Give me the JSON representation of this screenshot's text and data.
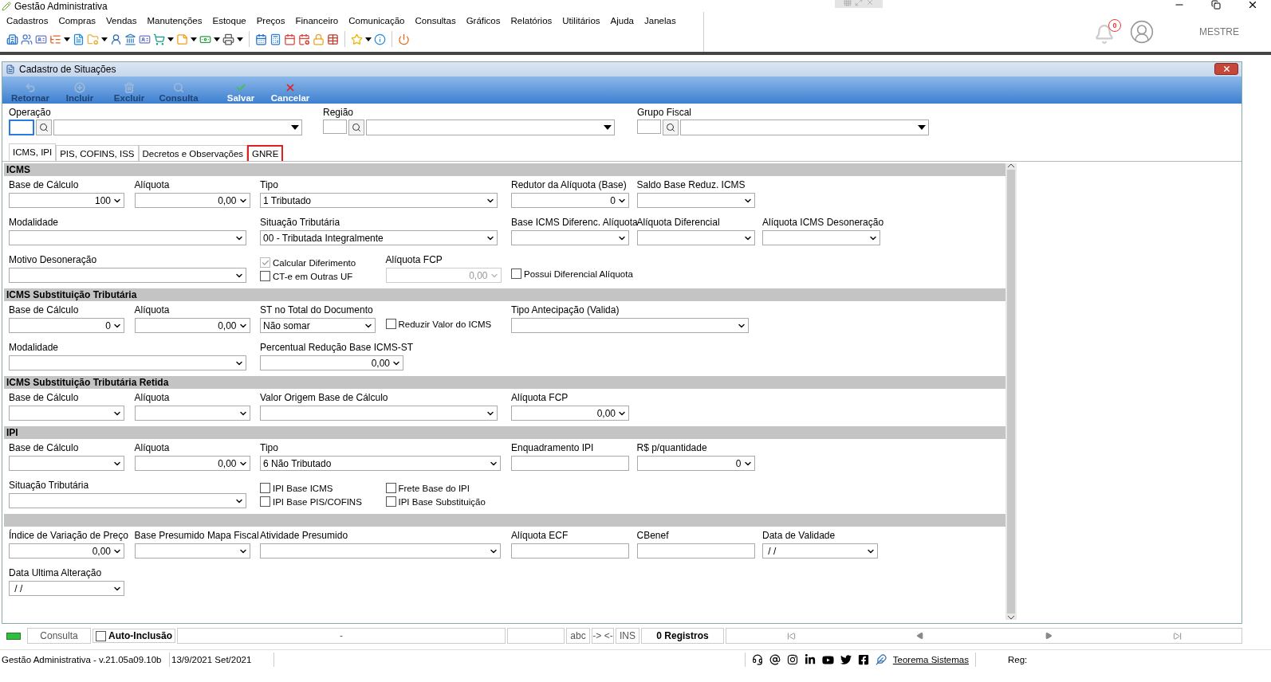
{
  "app": {
    "title": "Gestão Administrativa",
    "menu": [
      "Cadastros",
      "Compras",
      "Vendas",
      "Manutenções",
      "Estoque",
      "Preços",
      "Financeiro",
      "Comunicação",
      "Consultas",
      "Gráficos",
      "Relatórios",
      "Utilitários",
      "Ajuda",
      "Janelas"
    ],
    "notifications": "0",
    "user": "MESTRE"
  },
  "window": {
    "title": "Cadastro de Situações",
    "actions": [
      {
        "label": "Retornar",
        "disabled": true
      },
      {
        "label": "Incluir",
        "disabled": true
      },
      {
        "label": "Excluir",
        "disabled": true
      },
      {
        "label": "Consulta",
        "disabled": true
      },
      {
        "label": "Salvar",
        "disabled": false
      },
      {
        "label": "Cancelar",
        "disabled": false
      }
    ]
  },
  "filters": [
    {
      "label": "Operação",
      "focused": true
    },
    {
      "label": "Região",
      "focused": false
    },
    {
      "label": "Grupo Fiscal",
      "focused": false
    }
  ],
  "tabs": [
    {
      "label": "ICMS, IPI",
      "selected": true,
      "outlined": false
    },
    {
      "label": "PIS, COFINS, ISS",
      "selected": false,
      "outlined": false
    },
    {
      "label": "Decretos e Observações",
      "selected": false,
      "outlined": false
    },
    {
      "label": "GNRE",
      "selected": false,
      "outlined": true
    }
  ],
  "sections": [
    {
      "title": "ICMS",
      "fields": [
        {
          "kind": "number",
          "label": "Base de Cálculo",
          "value": "100",
          "disabled": false
        },
        {
          "kind": "number",
          "label": "Alíquota",
          "value": "0,00",
          "disabled": false
        },
        {
          "kind": "combo",
          "label": "Tipo",
          "value": "1 Tributado",
          "disabled": false
        },
        {
          "kind": "number",
          "label": "Redutor da Alíquota (Base)",
          "value": "0",
          "disabled": false
        },
        {
          "kind": "combo",
          "label": "Saldo Base Reduz. ICMS",
          "disabled": false
        },
        {
          "kind": "combo",
          "label": "Modalidade",
          "disabled": false
        },
        {
          "kind": "combo",
          "label": "Situação Tributária",
          "value": "00 - Tributada Integralmente",
          "disabled": false
        },
        {
          "kind": "combo",
          "label": "Base ICMS Diferenc. Alíquota",
          "disabled": false
        },
        {
          "kind": "combo",
          "label": "Alíquota Diferencial",
          "disabled": false
        },
        {
          "kind": "combo",
          "label": "Alíquota ICMS Desoneração",
          "disabled": false
        },
        {
          "kind": "combo",
          "label": "Motivo Desoneração",
          "disabled": false
        },
        {
          "kind": "checks",
          "items": [
            {
              "label": "Calcular Diferimento",
              "checked": true,
              "disabled": true
            },
            {
              "label": "CT-e em Outras UF",
              "checked": false,
              "disabled": false
            }
          ]
        },
        {
          "kind": "number",
          "label": "Alíquota FCP",
          "value": "0,00",
          "disabled": true
        },
        {
          "kind": "check",
          "label": "Possui Diferencial Alíquota",
          "checked": false,
          "disabled": false
        }
      ]
    },
    {
      "title": "ICMS Substituição Tributária",
      "fields": [
        {
          "kind": "number",
          "label": "Base de Cálculo",
          "value": "0",
          "disabled": false
        },
        {
          "kind": "number",
          "label": "Alíquota",
          "value": "0,00",
          "disabled": false
        },
        {
          "kind": "combo",
          "label": "ST no Total do Documento",
          "value": "Não somar",
          "disabled": false
        },
        {
          "kind": "check",
          "label": "Reduzir Valor do ICMS",
          "checked": false,
          "disabled": false
        },
        {
          "kind": "combo",
          "label": "Tipo Antecipação (Valida)",
          "disabled": false
        },
        {
          "kind": "combo",
          "label": "Modalidade",
          "disabled": false
        },
        {
          "kind": "number",
          "label": "Percentual Redução Base ICMS-ST",
          "value": "0,00",
          "disabled": false
        }
      ]
    },
    {
      "title": "ICMS Substituição Tributária Retida",
      "fields": [
        {
          "kind": "combo",
          "label": "Base de Cálculo",
          "disabled": false
        },
        {
          "kind": "combo",
          "label": "Alíquota",
          "disabled": false
        },
        {
          "kind": "combo",
          "label": "Valor Origem Base de Cálculo",
          "disabled": false
        },
        {
          "kind": "number",
          "label": "Alíquota FCP",
          "value": "0,00",
          "disabled": false
        }
      ]
    },
    {
      "title": "IPI",
      "fields": [
        {
          "kind": "combo",
          "label": "Base de Cálculo",
          "disabled": false
        },
        {
          "kind": "number",
          "label": "Alíquota",
          "value": "0,00",
          "disabled": false
        },
        {
          "kind": "combo",
          "label": "Tipo",
          "value": "6 Não Tributado",
          "disabled": false
        },
        {
          "kind": "text",
          "label": "Enquadramento IPI",
          "disabled": false
        },
        {
          "kind": "number",
          "label": "R$ p/quantidade",
          "value": "0",
          "disabled": false
        },
        {
          "kind": "combo",
          "label": "Situação Tributária",
          "disabled": false
        },
        {
          "kind": "checks",
          "items": [
            {
              "label": "IPI Base ICMS",
              "checked": false,
              "disabled": false
            },
            {
              "label": "IPI Base PIS/COFINS",
              "checked": false,
              "disabled": false
            }
          ]
        },
        {
          "kind": "checks",
          "items": [
            {
              "label": "Frete Base do IPI",
              "checked": false,
              "disabled": false
            },
            {
              "label": "IPI Base Substituição",
              "checked": false,
              "disabled": false
            }
          ]
        }
      ]
    },
    {
      "fields": [
        {
          "kind": "number",
          "label": "Índice de Variação de Preço",
          "value": "0,00",
          "disabled": false
        },
        {
          "kind": "combo",
          "label": "Base Presumido Mapa Fiscal",
          "disabled": false
        },
        {
          "kind": "combo",
          "label": "Atividade Presumido",
          "disabled": false
        },
        {
          "kind": "text",
          "label": "Alíquota ECF",
          "disabled": false
        },
        {
          "kind": "text",
          "label": "CBenef",
          "disabled": false
        },
        {
          "kind": "combo",
          "label": "Data de Validade",
          "value": " / /",
          "disabled": false
        },
        {
          "kind": "combo",
          "label": "Data Ultima Alteração",
          "value": " / /",
          "disabled": false
        }
      ]
    }
  ],
  "status_bar": {
    "mode": "Consulta",
    "auto_inclusion": {
      "label": "Auto-Inclusão",
      "checked": false
    },
    "field": "-",
    "spell": "abc",
    "arrows": "-> <-",
    "insert": "INS",
    "records": "0 Registros"
  },
  "footer": {
    "version": "Gestão Administrativa - v.21.05a09.10b",
    "date": "13/9/2021 Set/2021",
    "link": "Teorema Sistemas",
    "reg": "Reg:"
  }
}
